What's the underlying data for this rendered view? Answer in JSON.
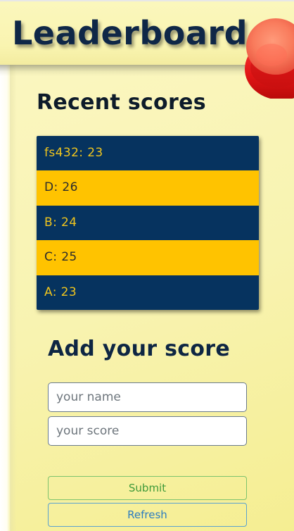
{
  "header": {
    "title": "Leaderboard"
  },
  "recent": {
    "title": "Recent scores",
    "scores": [
      {
        "text": "fs432: 23",
        "style": "dark"
      },
      {
        "text": "D: 26",
        "style": "gold"
      },
      {
        "text": "B: 24",
        "style": "dark"
      },
      {
        "text": "C: 25",
        "style": "gold"
      },
      {
        "text": "A: 23",
        "style": "dark"
      }
    ]
  },
  "form": {
    "title": "Add your score",
    "name_placeholder": "your name",
    "score_placeholder": "your score",
    "submit_label": "Submit",
    "refresh_label": "Refresh"
  },
  "colors": {
    "navy": "#06335f",
    "gold": "#ffc300",
    "paper": "#f8f3b0",
    "pin": "#e8202a"
  },
  "icons": {
    "pin": "pushpin-icon"
  }
}
